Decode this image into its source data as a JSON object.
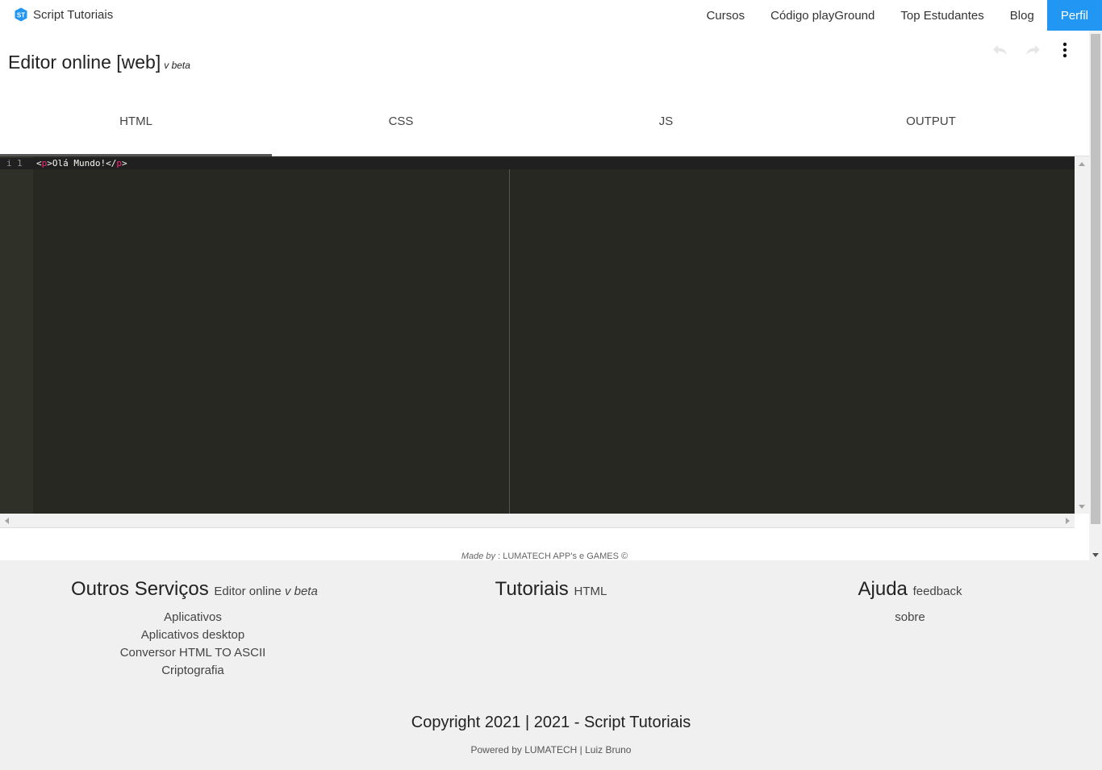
{
  "navbar": {
    "brand_logo": "ST",
    "brand": "Script Tutoriais",
    "links": [
      "Cursos",
      "Código playGround",
      "Top Estudantes",
      "Blog",
      "Perfil"
    ],
    "accent": "#2196f3"
  },
  "header": {
    "title": "Editor online [web]",
    "version": "v beta",
    "icons": [
      "undo-icon",
      "redo-icon",
      "more-vert-icon"
    ]
  },
  "tabs": [
    "HTML",
    "CSS",
    "JS",
    "OUTPUT"
  ],
  "active_tab": "HTML",
  "editor": {
    "line_number": "1",
    "line_info_icon": "i",
    "code": {
      "open_bracket": "<",
      "open_tag": "p",
      "close_bracket": ">",
      "text": "Olá Mundo!",
      "end_open": "</",
      "close_tag": "p",
      "end_close": ">"
    },
    "theme_bg": "#272822",
    "tag_color": "#f92672"
  },
  "madeby": {
    "label": "Made by",
    "separator": ":",
    "text": "LUMATECH APP's e GAMES ©"
  },
  "footer": {
    "col1": {
      "title": "Outros Serviços",
      "sub": "Editor online",
      "sub_em": "v beta",
      "items": [
        "Aplicativos",
        "Aplicativos desktop",
        "Conversor HTML TO ASCII",
        "Criptografia"
      ]
    },
    "col2": {
      "title": "Tutoriais",
      "sub": "HTML"
    },
    "col3": {
      "title": "Ajuda",
      "sub": "feedback",
      "items": [
        "sobre"
      ]
    },
    "copyright": "Copyright 2021 | 2021 - Script Tutoriais",
    "powered": "Powered by LUMATECH | Luiz Bruno"
  }
}
